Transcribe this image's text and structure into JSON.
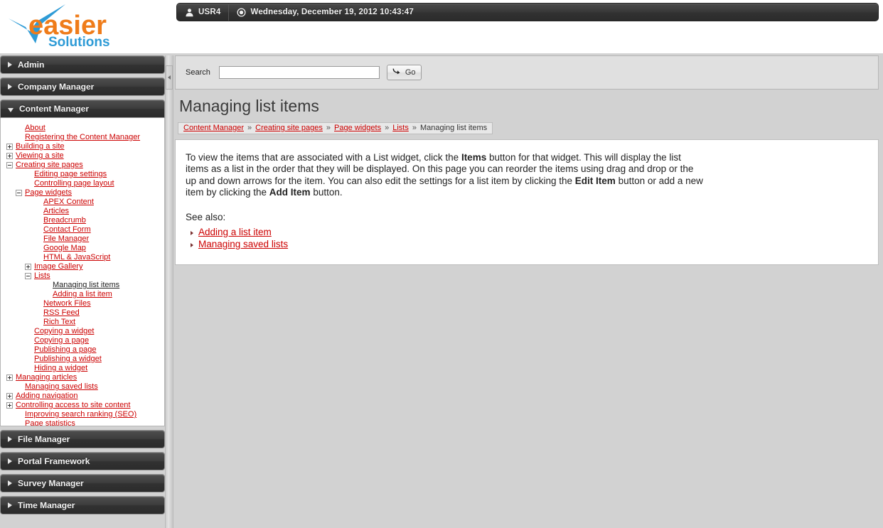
{
  "header": {
    "logo_text_primary": "easier",
    "logo_text_secondary": "Solutions",
    "user_icon": "user-icon",
    "username": "USR4",
    "clock_icon": "clock-icon",
    "datetime": "Wednesday, December 19, 2012 10:43:47"
  },
  "sidebar": {
    "accordions_top": [
      {
        "label": "Admin",
        "expanded": false
      },
      {
        "label": "Company Manager",
        "expanded": false
      },
      {
        "label": "Content Manager",
        "expanded": true
      }
    ],
    "accordions_bottom": [
      {
        "label": "File Manager",
        "expanded": false
      },
      {
        "label": "Portal Framework",
        "expanded": false
      },
      {
        "label": "Survey Manager",
        "expanded": false
      },
      {
        "label": "Time Manager",
        "expanded": false
      }
    ],
    "tree": [
      {
        "label": "About",
        "indent": 1,
        "toggle": "none",
        "current": false
      },
      {
        "label": "Registering the Content Manager",
        "indent": 1,
        "toggle": "none",
        "current": false
      },
      {
        "label": "Building a site",
        "indent": 0,
        "toggle": "plus",
        "current": false
      },
      {
        "label": "Viewing a site",
        "indent": 0,
        "toggle": "plus",
        "current": false
      },
      {
        "label": "Creating site pages",
        "indent": 0,
        "toggle": "minus",
        "current": false
      },
      {
        "label": "Editing page settings",
        "indent": 2,
        "toggle": "none",
        "current": false
      },
      {
        "label": "Controlling page layout",
        "indent": 2,
        "toggle": "none",
        "current": false
      },
      {
        "label": "Page widgets",
        "indent": 1,
        "toggle": "minus",
        "current": false
      },
      {
        "label": "APEX Content",
        "indent": 3,
        "toggle": "none",
        "current": false
      },
      {
        "label": "Articles",
        "indent": 3,
        "toggle": "none",
        "current": false
      },
      {
        "label": "Breadcrumb",
        "indent": 3,
        "toggle": "none",
        "current": false
      },
      {
        "label": "Contact Form",
        "indent": 3,
        "toggle": "none",
        "current": false
      },
      {
        "label": "File Manager",
        "indent": 3,
        "toggle": "none",
        "current": false
      },
      {
        "label": "Google Map",
        "indent": 3,
        "toggle": "none",
        "current": false
      },
      {
        "label": "HTML & JavaScript",
        "indent": 3,
        "toggle": "none",
        "current": false
      },
      {
        "label": "Image Gallery",
        "indent": 2,
        "toggle": "plus",
        "current": false
      },
      {
        "label": "Lists",
        "indent": 2,
        "toggle": "minus",
        "current": false
      },
      {
        "label": "Managing list items",
        "indent": 4,
        "toggle": "none",
        "current": true
      },
      {
        "label": "Adding a list item",
        "indent": 4,
        "toggle": "none",
        "current": false
      },
      {
        "label": "Network Files",
        "indent": 3,
        "toggle": "none",
        "current": false
      },
      {
        "label": "RSS Feed",
        "indent": 3,
        "toggle": "none",
        "current": false
      },
      {
        "label": "Rich Text",
        "indent": 3,
        "toggle": "none",
        "current": false
      },
      {
        "label": "Copying a widget",
        "indent": 2,
        "toggle": "none",
        "current": false
      },
      {
        "label": "Copying a page",
        "indent": 2,
        "toggle": "none",
        "current": false
      },
      {
        "label": "Publishing a page",
        "indent": 2,
        "toggle": "none",
        "current": false
      },
      {
        "label": "Publishing a widget",
        "indent": 2,
        "toggle": "none",
        "current": false
      },
      {
        "label": "Hiding a widget",
        "indent": 2,
        "toggle": "none",
        "current": false
      },
      {
        "label": "Managing articles",
        "indent": 0,
        "toggle": "plus",
        "current": false
      },
      {
        "label": "Managing saved lists",
        "indent": 1,
        "toggle": "none",
        "current": false
      },
      {
        "label": "Adding navigation",
        "indent": 0,
        "toggle": "plus",
        "current": false
      },
      {
        "label": "Controlling access to site content",
        "indent": 0,
        "toggle": "plus",
        "current": false
      },
      {
        "label": "Improving search ranking (SEO)",
        "indent": 1,
        "toggle": "none",
        "current": false
      },
      {
        "label": "Page statistics",
        "indent": 1,
        "toggle": "none",
        "current": false
      }
    ]
  },
  "search": {
    "label": "Search",
    "value": "",
    "placeholder": "",
    "go_label": "Go",
    "go_icon": "arrow-go-icon"
  },
  "page": {
    "title": "Managing list items",
    "breadcrumb": [
      {
        "label": "Content Manager",
        "link": true
      },
      {
        "label": "Creating site pages",
        "link": true
      },
      {
        "label": "Page widgets",
        "link": true
      },
      {
        "label": "Lists",
        "link": true
      },
      {
        "label": "Managing list items",
        "link": false
      }
    ],
    "breadcrumb_separator": "»",
    "body_parts": [
      {
        "text": "To view the items that are associated with a List widget, click the ",
        "bold": false
      },
      {
        "text": "Items",
        "bold": true
      },
      {
        "text": " button for that widget. This will display the list items as a list in the order that they will be displayed. On this page you can reorder the items using drag and drop or the up and down arrows for the item. You can also edit the settings for a list item by clicking the ",
        "bold": false
      },
      {
        "text": "Edit Item",
        "bold": true
      },
      {
        "text": " button or add a new item by clicking the ",
        "bold": false
      },
      {
        "text": "Add Item",
        "bold": true
      },
      {
        "text": " button.",
        "bold": false
      }
    ],
    "see_also_label": "See also:",
    "see_also_links": [
      "Adding a list item",
      "Managing saved lists"
    ]
  },
  "colors": {
    "link_red": "#cc0000",
    "page_bg": "#d2d2d2",
    "accordion_dark": "#3a3a3a",
    "logo_orange": "#ef7c1a",
    "logo_blue": "#2e9bd6"
  },
  "splitter": {
    "collapse_icon": "chevron-left-icon"
  }
}
